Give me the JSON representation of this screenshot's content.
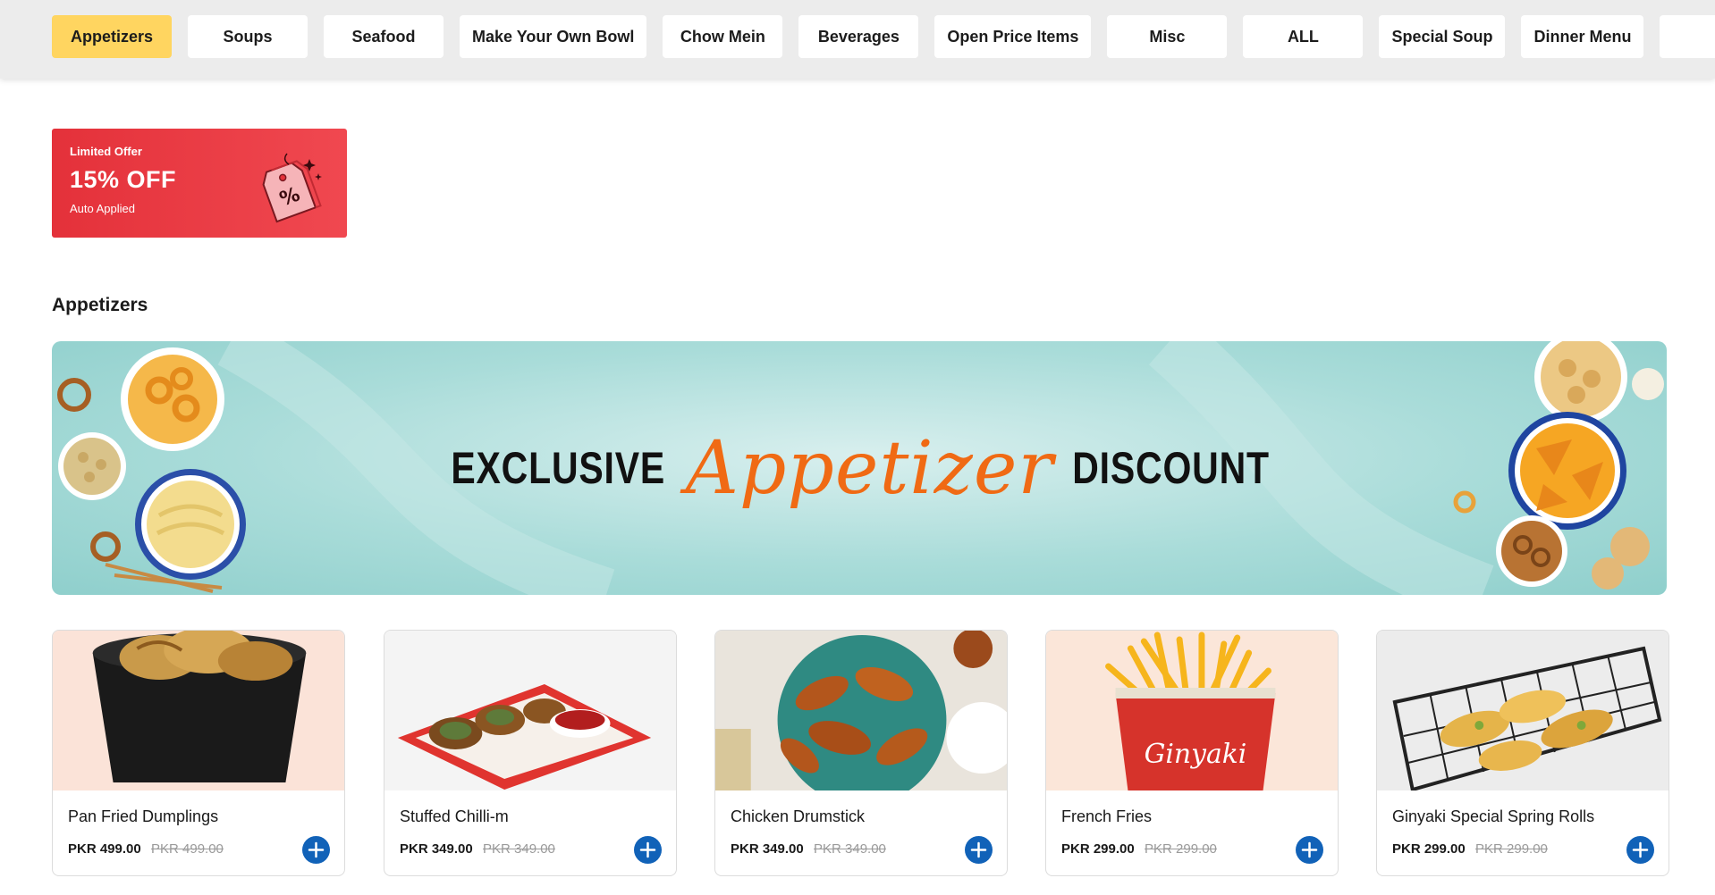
{
  "categories": [
    {
      "label": "Appetizers",
      "active": true
    },
    {
      "label": "Soups"
    },
    {
      "label": "Seafood"
    },
    {
      "label": "Make Your Own Bowl"
    },
    {
      "label": "Chow Mein"
    },
    {
      "label": "Beverages"
    },
    {
      "label": "Open Price Items"
    },
    {
      "label": "Misc"
    },
    {
      "label": "ALL"
    },
    {
      "label": "Special Soup"
    },
    {
      "label": "Dinner Menu"
    }
  ],
  "offer": {
    "line1": "Limited Offer",
    "headline": "15% OFF",
    "line3": "Auto Applied",
    "tag_symbol": "%"
  },
  "section": {
    "title": "Appetizers"
  },
  "banner": {
    "word_left": "EXCLUSIVE",
    "script": "Appetizer",
    "word_right": "DISCOUNT"
  },
  "products": [
    {
      "name": "Pan Fried Dumplings",
      "price": "PKR 499.00",
      "old_price": "PKR 499.00"
    },
    {
      "name": "Stuffed Chilli-m",
      "price": "PKR 349.00",
      "old_price": "PKR 349.00"
    },
    {
      "name": "Chicken Drumstick",
      "price": "PKR 349.00",
      "old_price": "PKR 349.00"
    },
    {
      "name": "French Fries",
      "price": "PKR 299.00",
      "old_price": "PKR 299.00"
    },
    {
      "name": "Ginyaki Special Spring Rolls",
      "price": "PKR 299.00",
      "old_price": "PKR 299.00"
    }
  ],
  "colors": {
    "active_category": "#ffd560",
    "offer_red": "#e4313a",
    "add_button": "#1162b8",
    "script_orange": "#f06a14"
  },
  "icons": {
    "offer": "discount-tag-icon",
    "add": "plus-circle-icon"
  }
}
